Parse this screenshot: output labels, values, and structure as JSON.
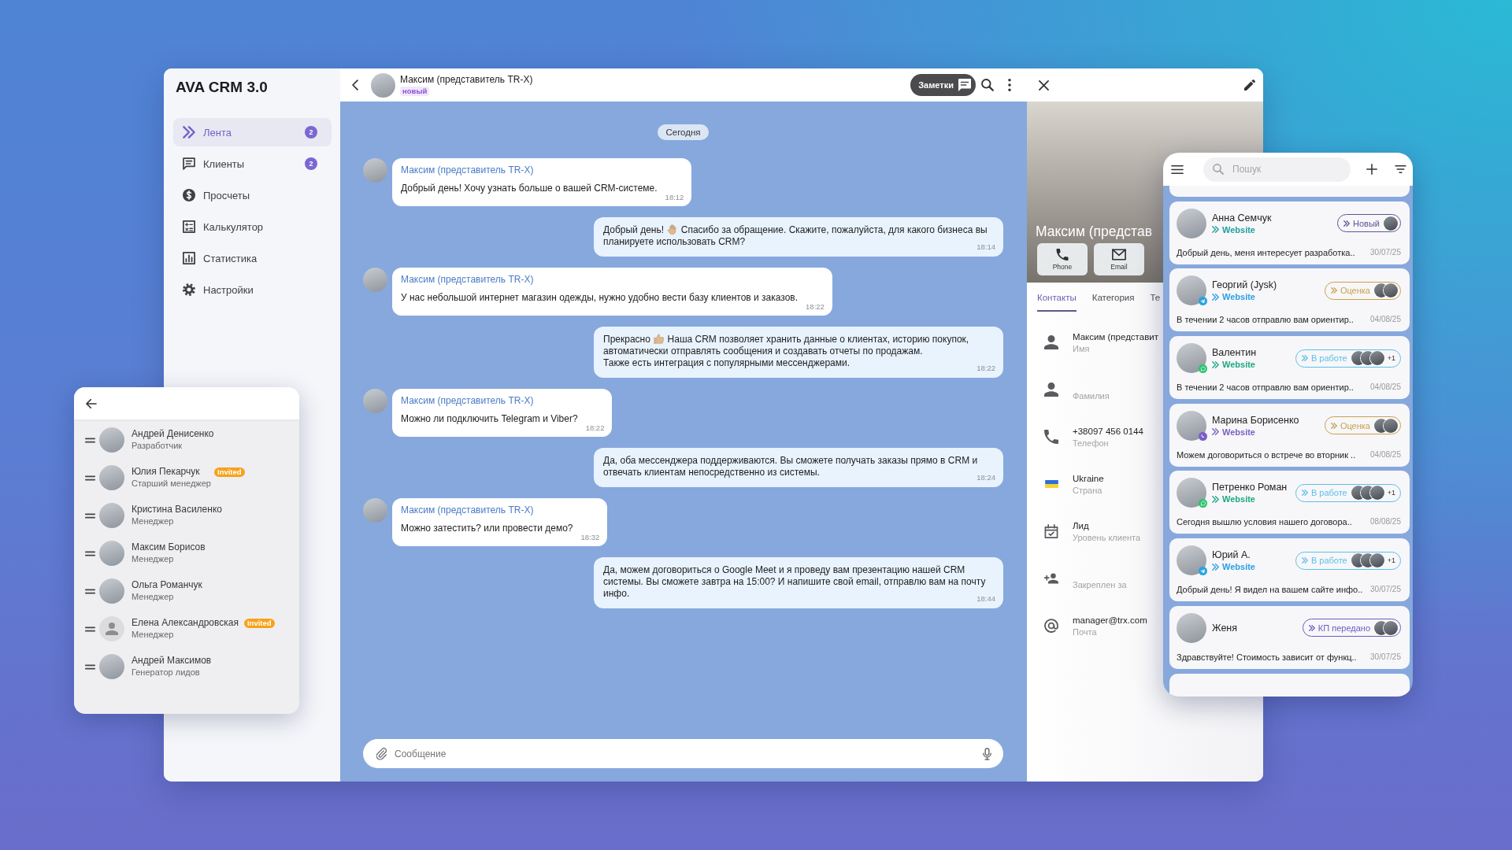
{
  "sidebar": {
    "title": "AVA CRM 3.0",
    "items": [
      {
        "kind": "feed",
        "label": "Лента",
        "badge": "2",
        "selected": true
      },
      {
        "kind": "clients",
        "label": "Клиенты",
        "badge": "2",
        "selected": false
      },
      {
        "kind": "estimates",
        "label": "Просчеты",
        "selected": false
      },
      {
        "kind": "calculator",
        "label": "Калькулятор",
        "selected": false
      },
      {
        "kind": "statistics",
        "label": "Статистика",
        "selected": false
      },
      {
        "kind": "settings",
        "label": "Настройки",
        "selected": false
      }
    ]
  },
  "chat": {
    "header": {
      "name": "Максим (представитель TR-X)",
      "status": "новый",
      "notes_button": "Заметки"
    },
    "date_divider": "Сегодня",
    "messages": [
      {
        "kind": "incoming",
        "sender": "Максим (представитель TR-X)",
        "segments": [
          {
            "kind": "text",
            "text": "Добрый день! Хочу узнать больше о вашей CRM-системе."
          }
        ],
        "time": "18:12"
      },
      {
        "kind": "outgoing",
        "segments": [
          {
            "kind": "text",
            "text": "Добрый день!"
          },
          {
            "kind": "wave"
          },
          {
            "kind": "text",
            "text": "Спасибо за обращение. Скажите, пожалуйста, для какого бизнеса вы планируете использовать CRM?"
          }
        ],
        "time": "18:14"
      },
      {
        "kind": "incoming",
        "sender": "Максим (представитель TR-X)",
        "segments": [
          {
            "kind": "text",
            "text": "У нас небольшой интернет магазин одежды, нужно удобно вести базу клиентов и заказов."
          }
        ],
        "time": "18:22"
      },
      {
        "kind": "outgoing",
        "segments": [
          {
            "kind": "text",
            "text": "Прекрасно"
          },
          {
            "kind": "thumbs-up"
          },
          {
            "kind": "text",
            "text": "Наша CRM позволяет хранить данные о клиентах, историю покупок, автоматически отправлять сообщения и создавать отчеты по продажам.\nТакже есть интеграция с популярными мессенджерами."
          }
        ],
        "time": "18:22"
      },
      {
        "kind": "incoming",
        "sender": "Максим (представитель TR-X)",
        "segments": [
          {
            "kind": "text",
            "text": "Можно ли подключить Telegram и Viber?"
          }
        ],
        "time": "18:22"
      },
      {
        "kind": "outgoing",
        "segments": [
          {
            "kind": "text",
            "text": "Да, оба мессенджера поддерживаются. Вы сможете получать заказы прямо в CRM и отвечать клиентам непосредственно из системы."
          }
        ],
        "time": "18:24"
      },
      {
        "kind": "incoming",
        "sender": "Максим (представитель TR-X)",
        "segments": [
          {
            "kind": "text",
            "text": "Можно затестить? или провести демо?"
          }
        ],
        "time": "18:32"
      },
      {
        "kind": "outgoing",
        "segments": [
          {
            "kind": "text",
            "text": "Да, можем договориться о Google Meet и я проведу вам презентацию нашей CRM системы. Вы сможете завтра на 15:00? И напишите свой email, отправлю вам на почту инфо."
          }
        ],
        "time": "18:44"
      }
    ],
    "composer": {
      "placeholder": "Сообщение"
    }
  },
  "contact": {
    "photo_caption": "Максим (представ",
    "actions": [
      {
        "kind": "phone",
        "label": "Phone"
      },
      {
        "kind": "email",
        "label": "Email"
      }
    ],
    "tabs": [
      {
        "label": "Контакты",
        "selected": true
      },
      {
        "label": "Категория",
        "selected": false
      },
      {
        "label": "Те",
        "selected": false
      }
    ],
    "fields": [
      {
        "kind": "person",
        "value": "Максим (представит",
        "label": "Имя"
      },
      {
        "kind": "person",
        "label": "Фамилия"
      },
      {
        "kind": "phone",
        "value": "+38097 456 0144",
        "label": "Телефон"
      },
      {
        "kind": "flag",
        "value": "Ukraine",
        "label": "Страна"
      },
      {
        "kind": "calendar",
        "value": "Лид",
        "label": "Уровень клиента"
      },
      {
        "kind": "person-add",
        "label": "Закреплен за"
      },
      {
        "kind": "email",
        "value": "manager@trx.com",
        "label": "Почта"
      }
    ]
  },
  "team_panel": {
    "members": [
      {
        "name": "Андрей Денисенко",
        "role": "Разработчик",
        "avatar": {
          "kind": "photo"
        }
      },
      {
        "name": "Юлия Пекарчук",
        "role": "Старший менеджер",
        "badge": "Invited",
        "avatar": {
          "kind": "photo"
        }
      },
      {
        "name": "Кристина Василенко",
        "role": "Менеджер",
        "avatar": {
          "kind": "photo"
        }
      },
      {
        "name": "Максим Борисов",
        "role": "Менеджер",
        "avatar": {
          "kind": "photo"
        }
      },
      {
        "name": "Ольга Романчук",
        "role": "Менеджер",
        "avatar": {
          "kind": "photo"
        }
      },
      {
        "name": "Елена Александровская",
        "role": "Менеджер",
        "badge": "Invited",
        "avatar": {
          "kind": "placeholder"
        }
      },
      {
        "name": "Андрей Максимов",
        "role": "Генератор лидов",
        "avatar": {
          "kind": "photo"
        }
      }
    ]
  },
  "leads_panel": {
    "search": {
      "placeholder": "Пошук"
    },
    "cards": [
      {
        "name": "Анна Семчук",
        "source": {
          "text": "Website",
          "color": "#1f9fa0"
        },
        "status": {
          "label": "Новый",
          "color": "#5f5398"
        },
        "assignees": [
          {
            "kind": "photo"
          }
        ],
        "preview": "Добрый день, меня интересует разработка..",
        "date": "30/07/25"
      },
      {
        "name": "Георгий (Jysk)",
        "channel": {
          "kind": "telegram"
        },
        "source": {
          "text": "Website",
          "color": "#2b9fe3"
        },
        "status": {
          "label": "Оценка",
          "color": "#c9a04a"
        },
        "assignees": [
          {
            "kind": "photo"
          },
          {
            "kind": "photo"
          }
        ],
        "preview": "В течении 2 часов отправлю вам ориентир..",
        "date": "04/08/25"
      },
      {
        "name": "Валентин",
        "channel": {
          "kind": "whatsapp"
        },
        "source": {
          "text": "Website",
          "color": "#1fa882"
        },
        "status": {
          "label": "В работе",
          "color": "#5cbfea"
        },
        "assignees": [
          {
            "kind": "photo"
          },
          {
            "kind": "photo"
          },
          {
            "kind": "photo"
          }
        ],
        "extra": "+1",
        "preview": "В течении 2 часов отправлю вам ориентир..",
        "date": "04/08/25"
      },
      {
        "name": "Марина Борисенко",
        "channel": {
          "kind": "viber"
        },
        "source": {
          "text": "Website",
          "color": "#7b5fc2"
        },
        "status": {
          "label": "Оценка",
          "color": "#c9a04a"
        },
        "assignees": [
          {
            "kind": "photo"
          },
          {
            "kind": "photo"
          }
        ],
        "preview": "Можем договориться о встрече во вторник ..",
        "date": "04/08/25"
      },
      {
        "name": "Петренко Роман",
        "channel": {
          "kind": "whatsapp"
        },
        "source": {
          "text": "Website",
          "color": "#1fa882"
        },
        "status": {
          "label": "В работе",
          "color": "#5cbfea"
        },
        "assignees": [
          {
            "kind": "photo"
          },
          {
            "kind": "photo"
          },
          {
            "kind": "photo"
          }
        ],
        "extra": "+1",
        "preview": "Сегодня вышлю условия нашего договора..",
        "date": "08/08/25"
      },
      {
        "name": "Юрий А.",
        "channel": {
          "kind": "telegram"
        },
        "source": {
          "text": "Website",
          "color": "#2b9fe3"
        },
        "status": {
          "label": "В работе",
          "color": "#5cbfea"
        },
        "assignees": [
          {
            "kind": "photo"
          },
          {
            "kind": "photo"
          },
          {
            "kind": "photo"
          }
        ],
        "extra": "+1",
        "preview": "Добрый день! Я видел на вашем сайте инфо..",
        "date": "30/07/25"
      },
      {
        "name": "Женя",
        "status": {
          "label": "КП передано",
          "color": "#6e5bbf"
        },
        "assignees": [
          {
            "kind": "photo"
          },
          {
            "kind": "photo"
          }
        ],
        "preview": "Здравствуйте! Стоимость зависит от функц..",
        "date": "30/07/25"
      }
    ]
  }
}
